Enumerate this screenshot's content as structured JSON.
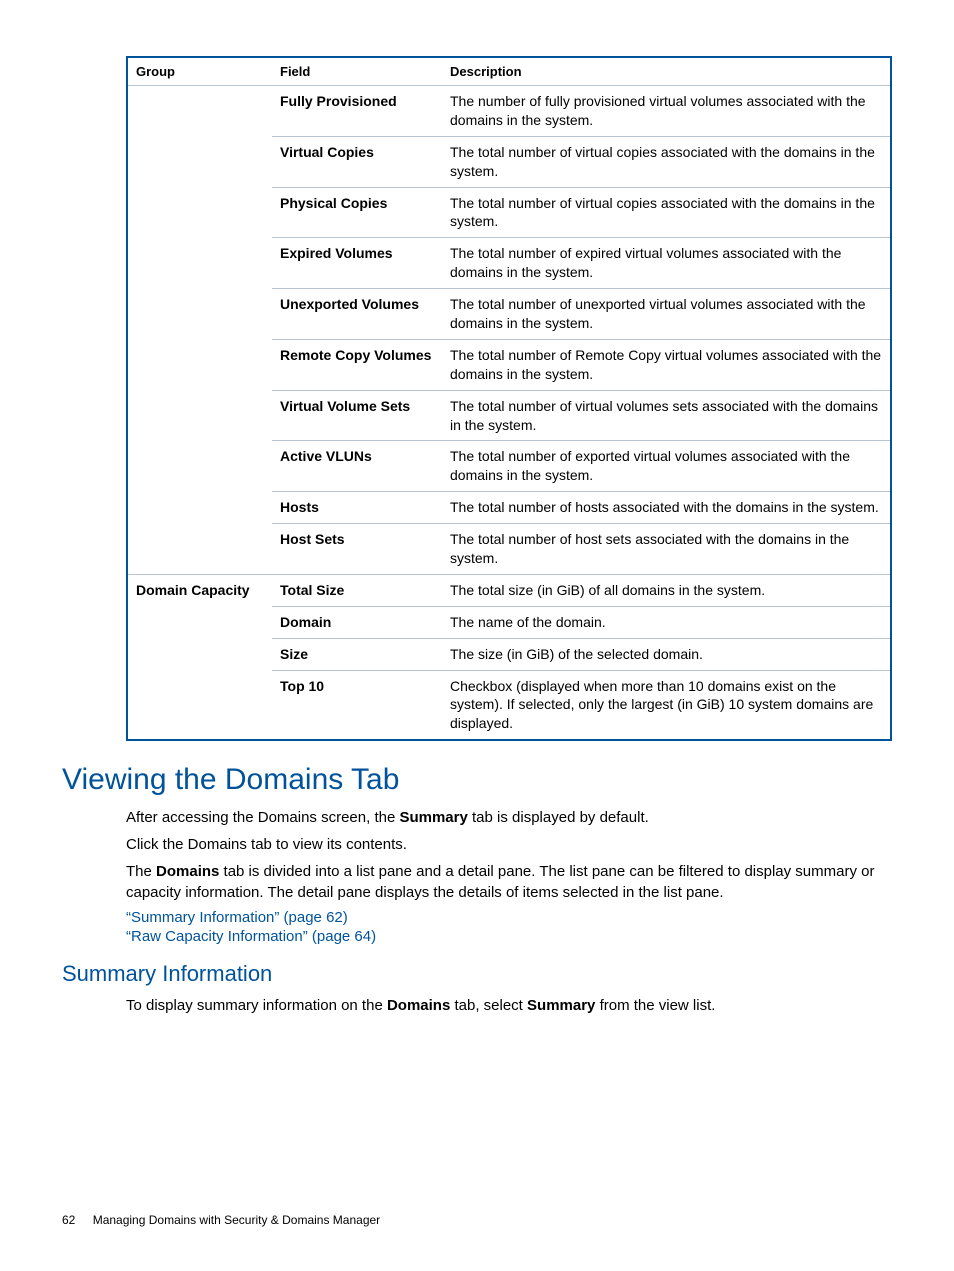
{
  "table": {
    "headers": {
      "group": "Group",
      "field": "Field",
      "description": "Description"
    },
    "rows": [
      {
        "group": "",
        "field": "Fully Provisioned",
        "description": "The number of fully provisioned virtual volumes associated with the domains in the system."
      },
      {
        "group": "",
        "field": "Virtual Copies",
        "description": "The total number of virtual copies associated with the domains in the system."
      },
      {
        "group": "",
        "field": "Physical Copies",
        "description": "The total number of virtual copies associated with the domains in the system."
      },
      {
        "group": "",
        "field": "Expired Volumes",
        "description": "The total number of expired virtual volumes associated with the domains in the system."
      },
      {
        "group": "",
        "field": "Unexported Volumes",
        "description": "The total number of unexported virtual volumes associated with the domains in the system."
      },
      {
        "group": "",
        "field": "Remote Copy Volumes",
        "description": "The total number of Remote Copy virtual volumes associated with the domains in the system."
      },
      {
        "group": "",
        "field": "Virtual Volume Sets",
        "description": "The total number of virtual volumes sets associated with the domains in the system."
      },
      {
        "group": "",
        "field": "Active VLUNs",
        "description": "The total number of exported virtual volumes associated with the domains in the system."
      },
      {
        "group": "",
        "field": "Hosts",
        "description": "The total number of hosts associated with the domains in the system."
      },
      {
        "group": "",
        "field": "Host Sets",
        "description": "The total number of host sets associated with the domains in the system."
      },
      {
        "group": "Domain Capacity",
        "field": "Total Size",
        "description": "The total size (in GiB) of all domains in the system."
      },
      {
        "group": "",
        "field": "Domain",
        "description": "The name of the domain."
      },
      {
        "group": "",
        "field": "Size",
        "description": "The size (in GiB) of the selected domain."
      },
      {
        "group": "",
        "field": "Top 10",
        "description": "Checkbox (displayed when more than 10 domains exist on the system). If selected, only the largest (in GiB) 10 system domains are displayed."
      }
    ]
  },
  "section": {
    "title": "Viewing the Domains Tab",
    "p1_a": "After accessing the Domains screen, the ",
    "p1_b": "Summary",
    "p1_c": " tab is displayed by default.",
    "p2": "Click the Domains tab to view its contents.",
    "p3_a": "The ",
    "p3_b": "Domains",
    "p3_c": " tab is divided into a list pane and a detail pane. The list pane can be filtered to display summary or capacity information. The detail pane displays the details of items selected in the list pane.",
    "link1": "“Summary Information” (page 62)",
    "link2": "“Raw Capacity Information” (page 64)"
  },
  "subsection": {
    "title": "Summary Information",
    "p1_a": "To display summary information on the ",
    "p1_b": "Domains",
    "p1_c": " tab, select ",
    "p1_d": "Summary",
    "p1_e": " from the view list."
  },
  "footer": {
    "page": "62",
    "chapter": "Managing Domains with Security & Domains Manager"
  }
}
